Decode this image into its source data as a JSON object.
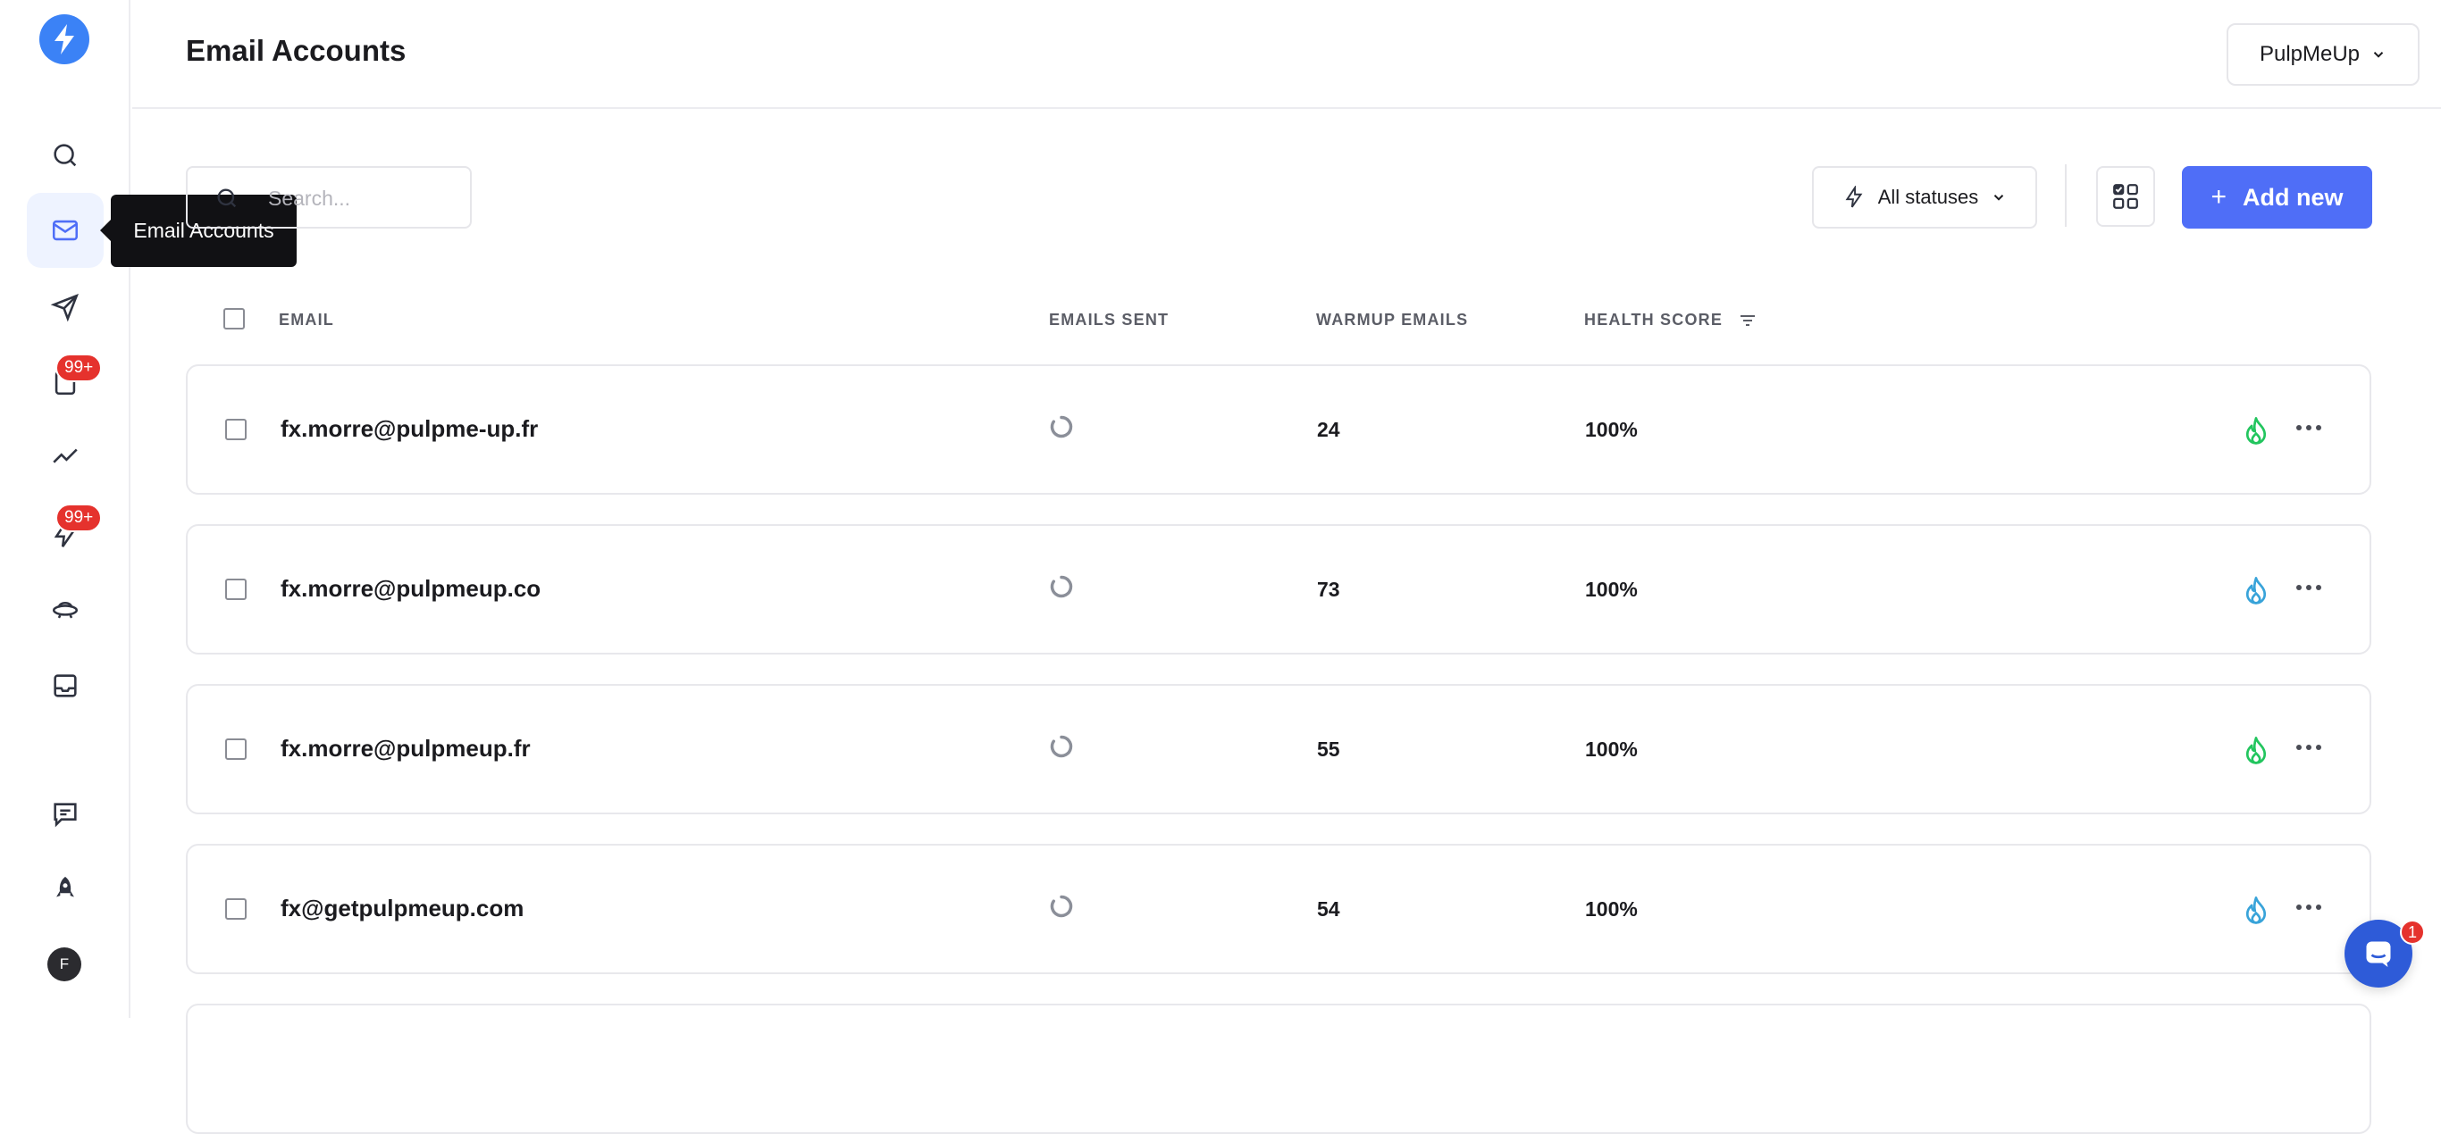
{
  "header": {
    "title": "Email Accounts",
    "workspace": "PulpMeUp"
  },
  "sidebar": {
    "tooltip": "Email Accounts",
    "items": [
      {
        "icon": "search-icon"
      },
      {
        "icon": "mail-icon",
        "active": true
      },
      {
        "icon": "send-icon"
      },
      {
        "icon": "clipboard-icon",
        "badge": "99+"
      },
      {
        "icon": "analytics-icon"
      },
      {
        "icon": "lightning-icon",
        "badge": "99+"
      },
      {
        "icon": "ufo-icon"
      },
      {
        "icon": "inbox-icon"
      },
      {
        "icon": "chat-icon"
      },
      {
        "icon": "rocket-icon"
      }
    ],
    "avatar": "F"
  },
  "toolbar": {
    "search_placeholder": "Search...",
    "status_filter": "All statuses",
    "add_label": "Add new",
    "add_plus": "+"
  },
  "table": {
    "columns": {
      "email": "EMAIL",
      "emails_sent": "EMAILS SENT",
      "warmup": "WARMUP EMAILS",
      "health": "HEALTH SCORE"
    },
    "rows": [
      {
        "email": "fx.morre@pulpme-up.fr",
        "warmup": "24",
        "health": "100%",
        "flame_color": "#22c55e"
      },
      {
        "email": "fx.morre@pulpmeup.co",
        "warmup": "73",
        "health": "100%",
        "flame_color": "#38a3d9"
      },
      {
        "email": "fx.morre@pulpmeup.fr",
        "warmup": "55",
        "health": "100%",
        "flame_color": "#22c55e"
      },
      {
        "email": "fx@getpulpmeup.com",
        "warmup": "54",
        "health": "100%",
        "flame_color": "#38a3d9"
      }
    ]
  },
  "chat": {
    "badge": "1"
  },
  "colors": {
    "accent": "#4f6ef7",
    "logo": "#3b82f6",
    "badge": "#e5322d"
  }
}
